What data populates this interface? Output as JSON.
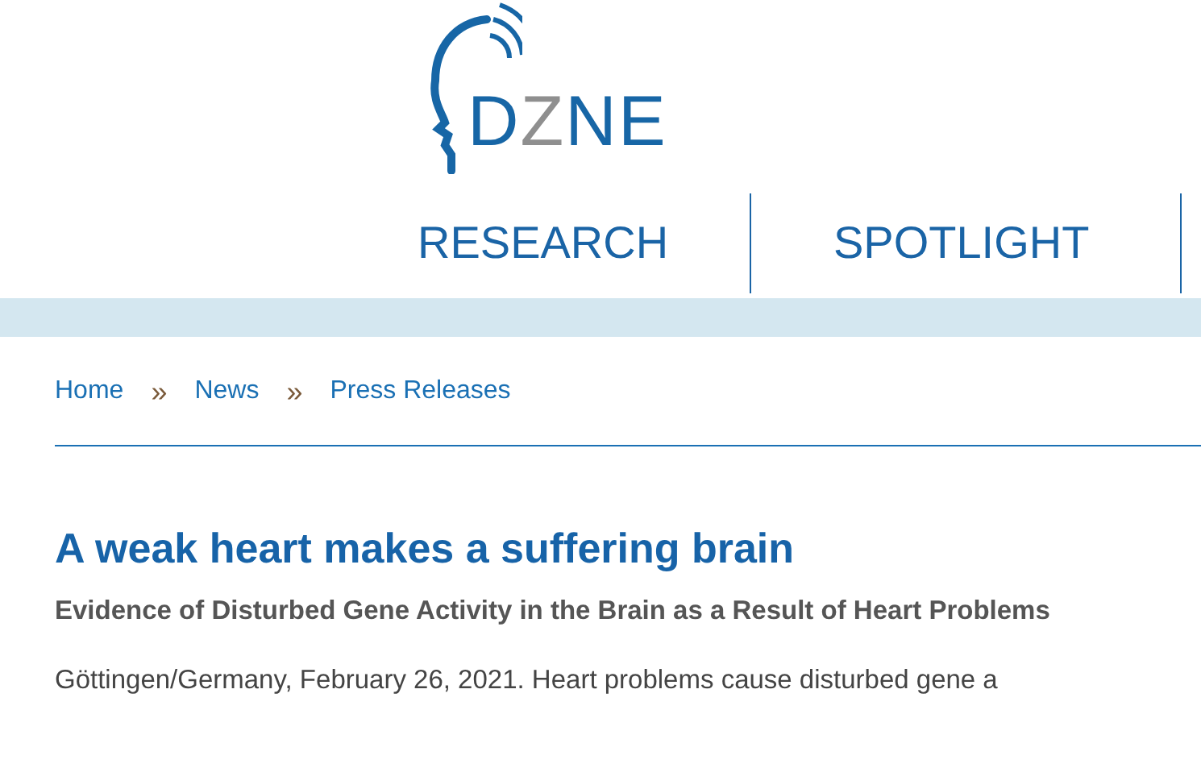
{
  "logo": {
    "parts": [
      {
        "text": "D",
        "accent": false
      },
      {
        "text": "Z",
        "accent": true
      },
      {
        "text": "NE",
        "accent": false
      }
    ]
  },
  "nav": [
    {
      "label": "RESEARCH"
    },
    {
      "label": "SPOTLIGHT"
    }
  ],
  "breadcrumb": [
    {
      "label": "Home"
    },
    {
      "label": "News"
    },
    {
      "label": "Press Releases"
    }
  ],
  "breadcrumb_separator": "»",
  "article": {
    "title": "A weak heart makes a suffering brain",
    "subtitle": "Evidence of Disturbed Gene Activity in the Brain as a Result of Heart Problems",
    "lead": "Göttingen/Germany, February 26, 2021. Heart problems cause disturbed gene a"
  }
}
